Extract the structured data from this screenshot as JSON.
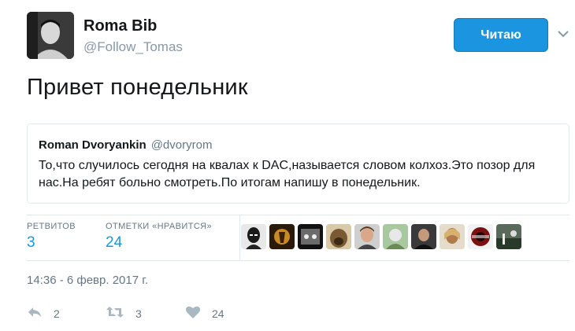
{
  "author": {
    "name": "Roma Bib",
    "handle": "@Follow_Tomas",
    "avatar_icon": "user-avatar"
  },
  "follow_button": {
    "label": "Читаю",
    "color": "#1b95e0"
  },
  "caret_icon": "chevron-down-icon",
  "tweet": {
    "text": "Привет понедельник"
  },
  "quoted_tweet": {
    "name": "Roman Dvoryankin",
    "handle": "@dvoryrom",
    "text": "То,что случилось сегодня на квалах к DAC,называется словом колхоз.Это позор для нас.На ребят больно смотреть.По итогам напишу в понедельник."
  },
  "stats": {
    "retweets_label": "РЕТВИТОВ",
    "retweets_value": "3",
    "likes_label": "ОТМЕТКИ «НРАВИТСЯ»",
    "likes_value": "24",
    "liker_avatars": [
      "avatar-1",
      "avatar-2",
      "avatar-3",
      "avatar-4",
      "avatar-5",
      "avatar-6",
      "avatar-7",
      "avatar-8",
      "avatar-9"
    ]
  },
  "timestamp": "14:36 - 6 февр. 2017 г.",
  "actions": {
    "reply": {
      "icon": "reply-icon",
      "count": "2"
    },
    "retweet": {
      "icon": "retweet-icon",
      "count": "3"
    },
    "like": {
      "icon": "heart-icon",
      "count": "24"
    }
  },
  "colors": {
    "accent": "#1b95e0",
    "muted": "#657786",
    "border": "#e1e8ed"
  }
}
